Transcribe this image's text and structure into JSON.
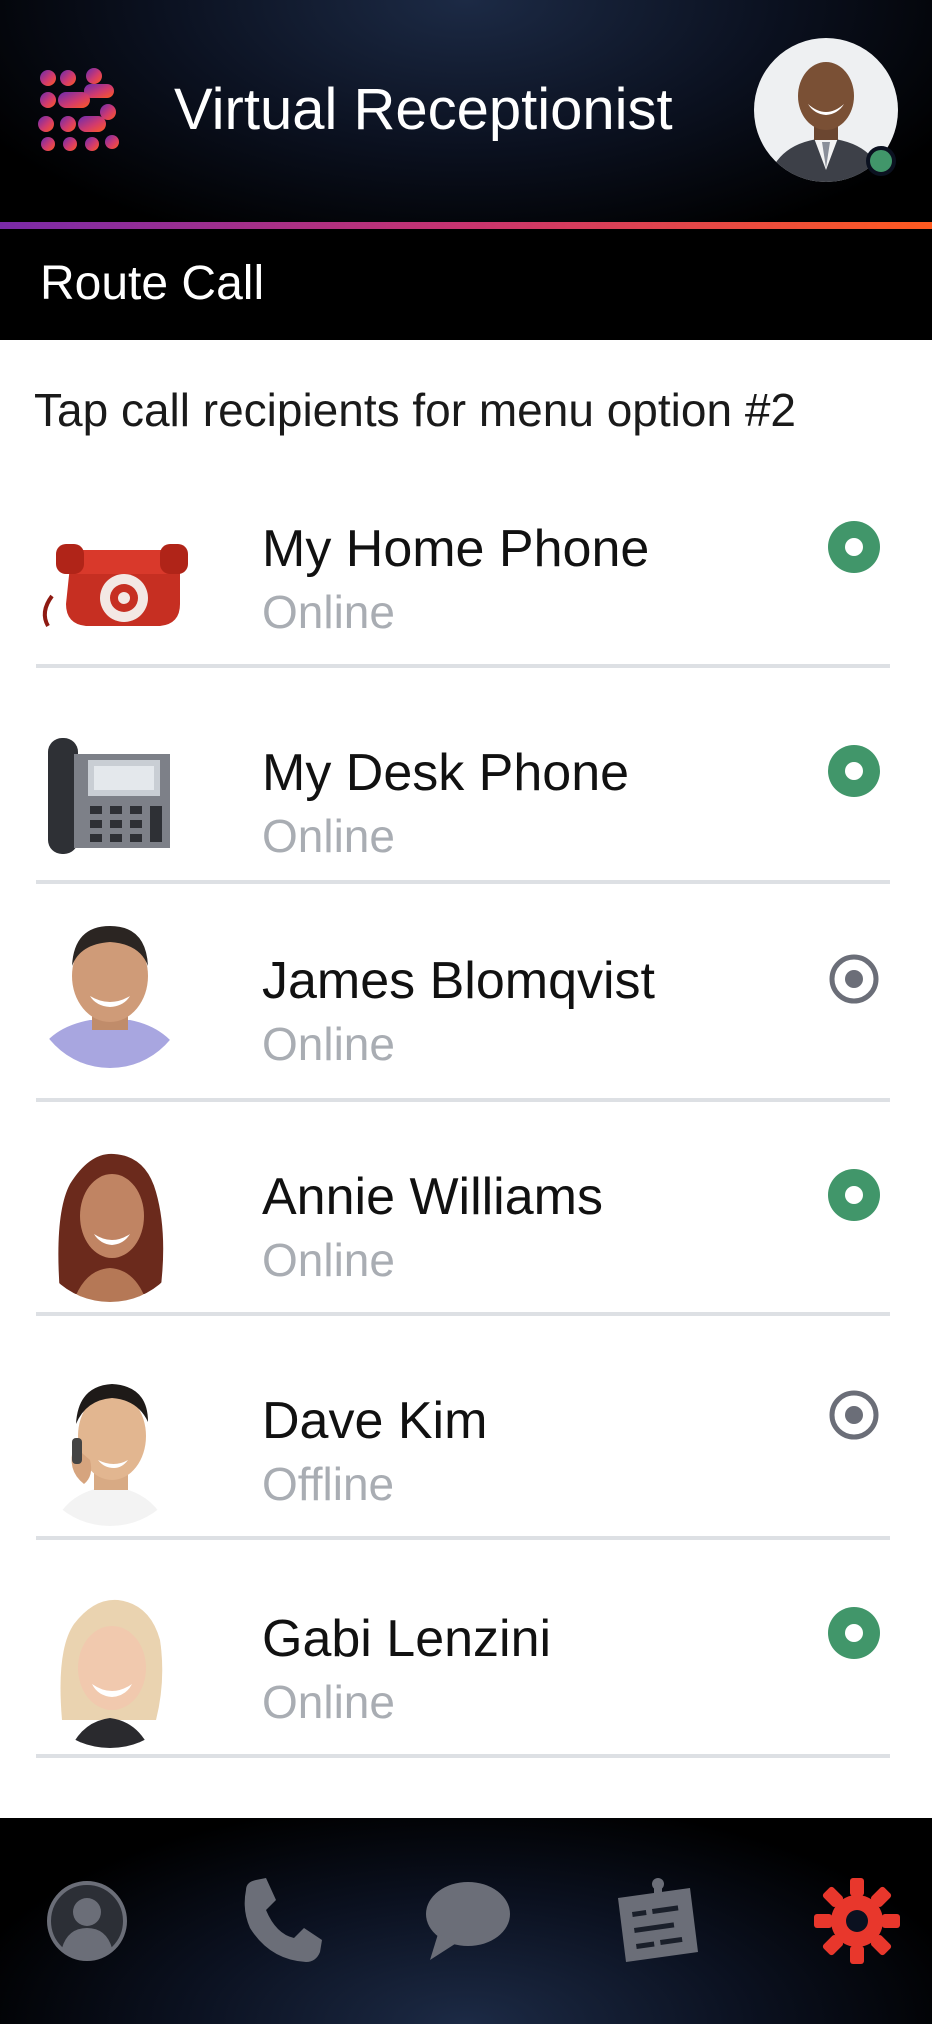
{
  "header": {
    "title": "Virtual Receptionist",
    "logo_icon": "dot-grid-logo-icon",
    "avatar_icon": "user-avatar-icon",
    "presence_color": "#41966a"
  },
  "subheader": {
    "title": "Route Call"
  },
  "instruction": "Tap call recipients for menu option #2",
  "recipients": [
    {
      "name": "My Home Phone",
      "status": "Online",
      "icon": "rotary-phone-icon",
      "selected": true
    },
    {
      "name": "My Desk Phone",
      "status": "Online",
      "icon": "desk-phone-icon",
      "selected": true
    },
    {
      "name": "James Blomqvist",
      "status": "Online",
      "icon": "person-photo-icon",
      "selected": false
    },
    {
      "name": "Annie Williams",
      "status": "Online",
      "icon": "person-photo-icon",
      "selected": true
    },
    {
      "name": "Dave Kim",
      "status": "Offline",
      "icon": "person-photo-icon",
      "selected": false
    },
    {
      "name": "Gabi Lenzini",
      "status": "Online",
      "icon": "person-photo-icon",
      "selected": true
    }
  ],
  "colors": {
    "accent_start": "#7a2aa8",
    "accent_end": "#ff5a1f",
    "selected_green": "#41966a",
    "unselected_gray": "#6b6e78",
    "status_gray": "#a9adb3",
    "settings_active": "#e8372c"
  },
  "tabs": [
    {
      "icon": "contacts-icon",
      "active": false
    },
    {
      "icon": "phone-icon",
      "active": false
    },
    {
      "icon": "chat-icon",
      "active": false
    },
    {
      "icon": "notes-icon",
      "active": false
    },
    {
      "icon": "settings-gear-icon",
      "active": true
    }
  ]
}
